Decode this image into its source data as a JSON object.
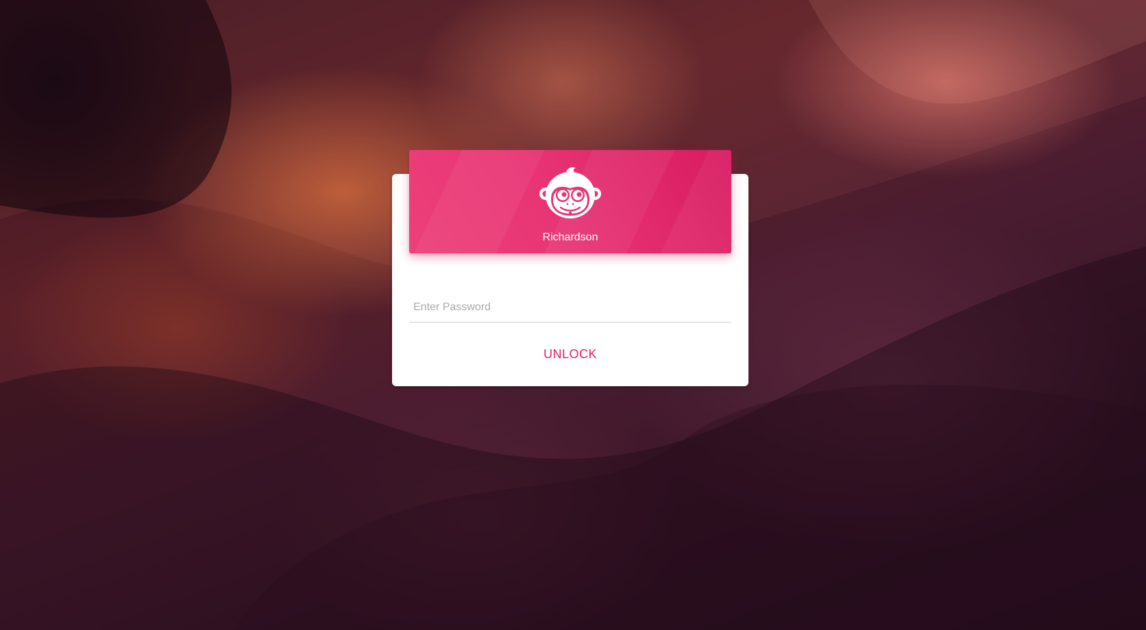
{
  "lock_screen": {
    "user_name": "Richardson",
    "password_placeholder": "Enter Password",
    "password_value": "",
    "unlock_label": "UNLOCK",
    "avatar_icon": "monkey-face-icon"
  },
  "colors": {
    "accent": "#e91e63",
    "header_start": "#ec407a",
    "header_end": "#d81b60",
    "card_background": "#ffffff"
  }
}
